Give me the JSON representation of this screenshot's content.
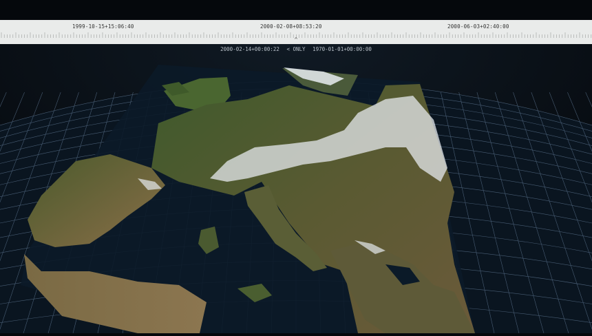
{
  "timeline": {
    "labels": [
      "1999-10-15+15:06:40",
      "2000-02-08+08:53:20",
      "2000-06-03+02:40:00"
    ],
    "collapse_glyph": "^"
  },
  "status": {
    "current_time": "2000-02-14+00:00:22",
    "toggle_label": "< ONLY",
    "reference_time": "1970-01-01+00:00:00"
  },
  "map": {
    "colors": {
      "background": "#05080c",
      "grid": "#5d7590",
      "sea": "#0b1a28",
      "land": "#4f5a32",
      "snow": "#e6eaee"
    }
  }
}
